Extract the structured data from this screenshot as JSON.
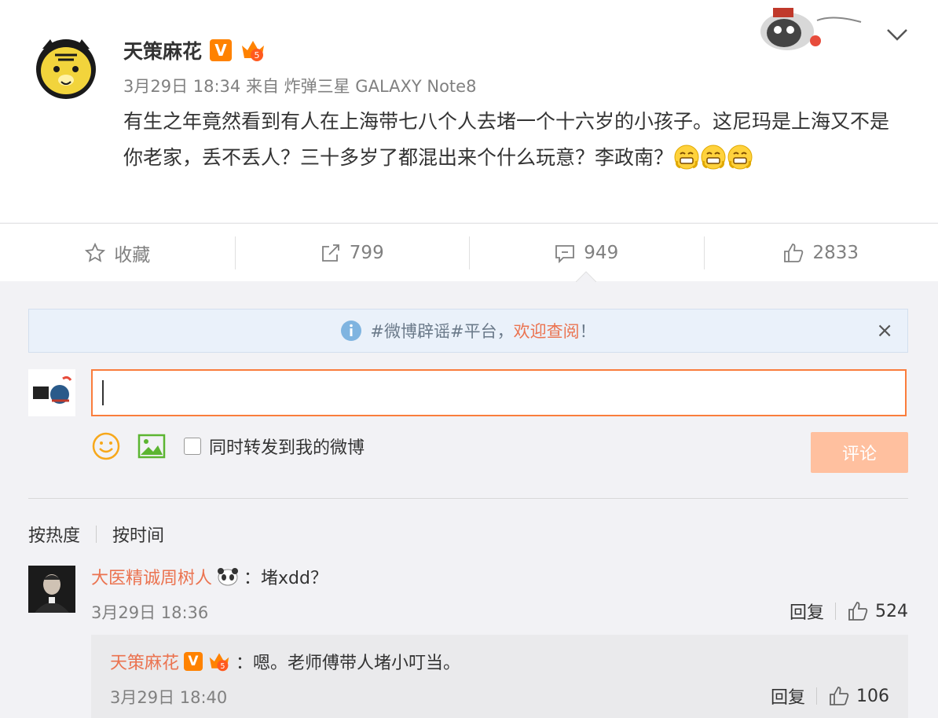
{
  "post": {
    "username": "天策麻花",
    "verified_badge": "V",
    "meta": "3月29日 18:34 来自 炸弹三星 GALAXY Note8",
    "text": "有生之年竟然看到有人在上海带七八个人去堵一个十六岁的小孩子。这尼玛是上海又不是你老家，丢不丢人？三十多岁了都混出来个什么玩意？李政南？",
    "emoji_count": 3
  },
  "actions": {
    "favorite_label": "收藏",
    "repost_count": "799",
    "comment_count": "949",
    "like_count": "2833"
  },
  "notice": {
    "prefix": "#微博辟谣#平台，",
    "link": "欢迎查阅",
    "suffix": "！",
    "close": "×"
  },
  "composer": {
    "input_value": "",
    "repost_label": "同时转发到我的微博",
    "submit_label": "评论"
  },
  "sort": {
    "by_hot": "按热度",
    "by_time": "按时间"
  },
  "comments": [
    {
      "username": "大医精诚周树人",
      "text": "：堵xdd？",
      "time": "3月29日 18:36",
      "reply_label": "回复",
      "likes": "524",
      "replies": [
        {
          "username": "天策麻花",
          "verified_badge": "V",
          "text": "：嗯。老师傅带人堵小叮当。",
          "time": "3月29日 18:40",
          "reply_label": "回复",
          "likes": "106"
        }
      ]
    }
  ],
  "colors": {
    "accent": "#eb7350",
    "verified": "#ff8200",
    "submit_disabled": "#ffc09f",
    "page_bg": "#f2f2f5"
  },
  "icons": [
    "star-icon",
    "repost-icon",
    "comment-icon",
    "like-icon",
    "info-icon",
    "smiley-icon",
    "image-icon",
    "chevron-down-icon"
  ]
}
